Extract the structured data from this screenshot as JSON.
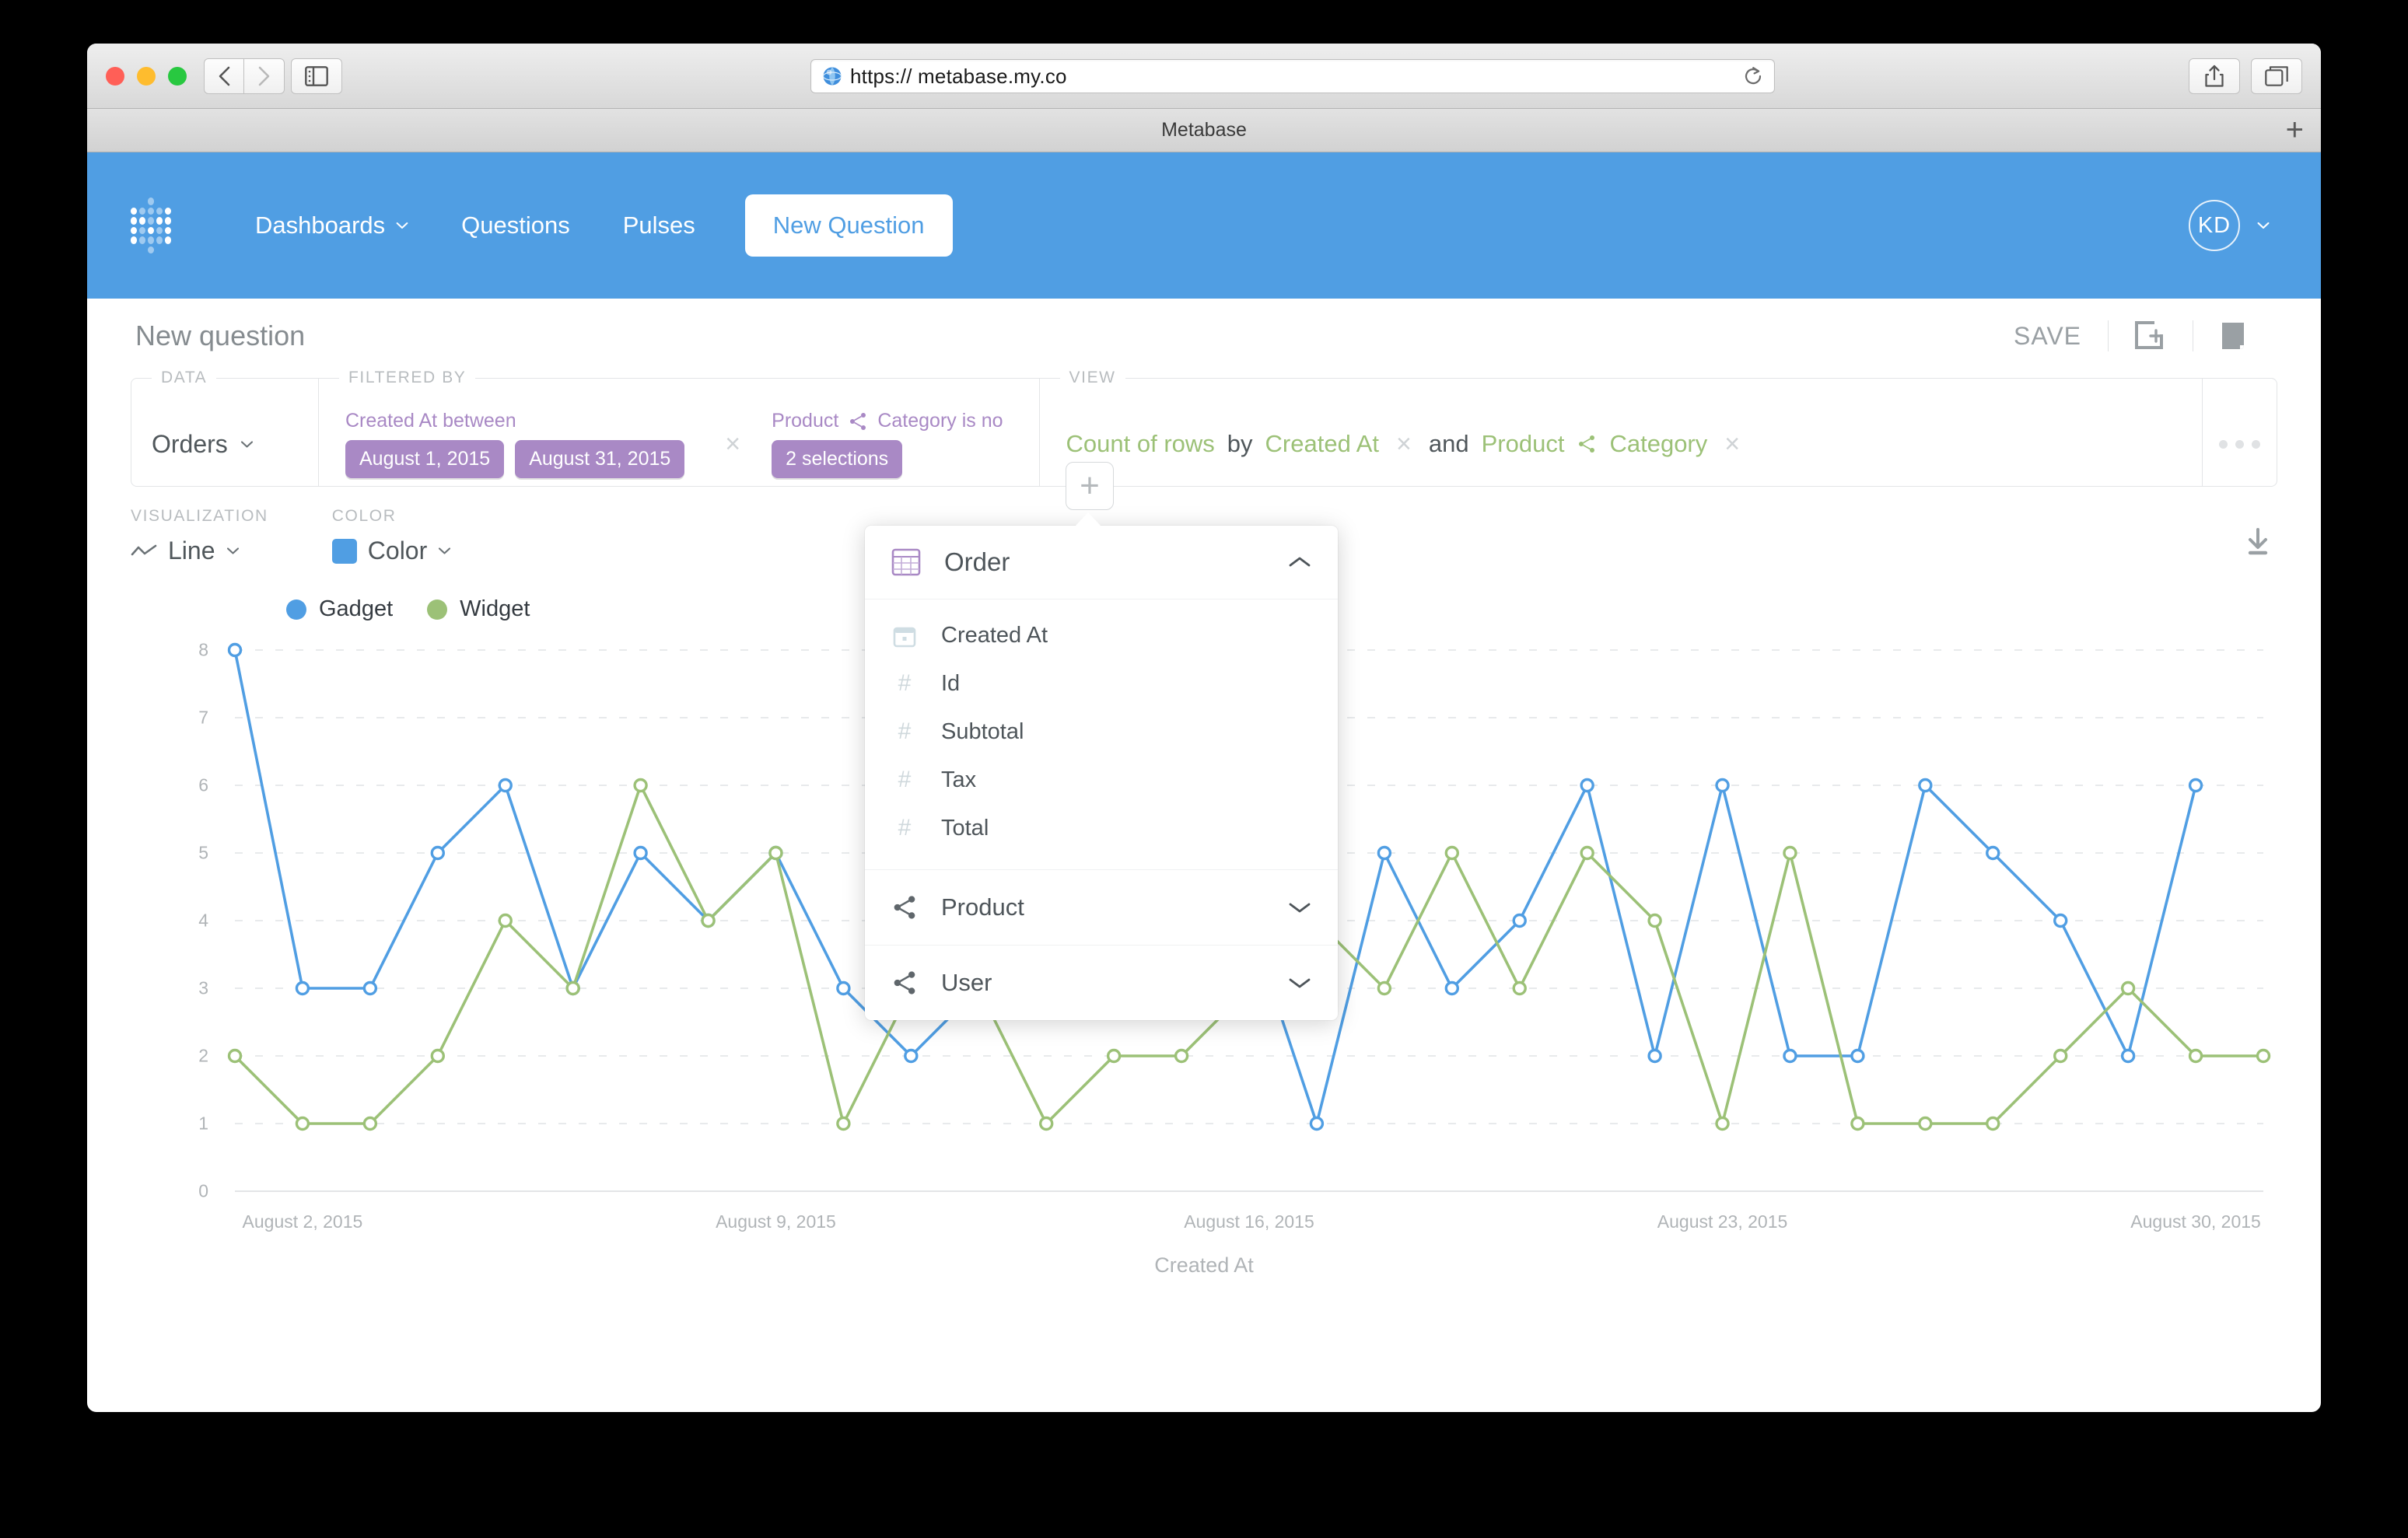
{
  "browser": {
    "url": "https:// metabase.my.co",
    "tab_title": "Metabase",
    "new_tab_label": "+",
    "back_icon": "chevron-left-icon",
    "forward_icon": "chevron-right-icon",
    "sidebar_icon": "sidebar-icon",
    "reload_icon": "reload-icon",
    "share_icon": "share-icon",
    "tabs_icon": "tabs-icon"
  },
  "nav": {
    "brand": "metabase-logo",
    "items": [
      {
        "label": "Dashboards",
        "has_caret": true
      },
      {
        "label": "Questions",
        "has_caret": false
      },
      {
        "label": "Pulses",
        "has_caret": false
      }
    ],
    "new_question": "New Question",
    "avatar_initials": "KD",
    "accent": "#509ee3"
  },
  "header": {
    "title": "New question",
    "save_label": "SAVE",
    "add_to_dashboard_icon": "add-to-dashboard-icon",
    "history_icon": "history-icon"
  },
  "query": {
    "data_label": "DATA",
    "data_value": "Orders",
    "filtered_label": "FILTERED BY",
    "filters": [
      {
        "title": "Created At between",
        "pills": [
          "August 1, 2015",
          "August 31, 2015"
        ],
        "remove": "×"
      },
      {
        "title_left": "Product",
        "title_right": "Category is no",
        "pills": [
          "2 selections"
        ],
        "join_icon": "join-icon"
      }
    ],
    "add_filter_label": "+",
    "view_label": "VIEW",
    "view": {
      "metric": "Count of rows",
      "by": "by",
      "dim1": "Created At",
      "remove1": "×",
      "and": "and",
      "dim2_table": "Product",
      "dim2_field": "Category",
      "remove2": "×",
      "join_icon": "join-icon"
    },
    "more_label": "…",
    "filter_color": "#a989c5",
    "view_color": "#9cc177"
  },
  "viz": {
    "visualization_label": "VISUALIZATION",
    "visualization_value": "Line",
    "color_label": "COLOR",
    "color_value": "Color",
    "color_swatch": "#509ee3",
    "download_icon": "download-icon"
  },
  "popover": {
    "section_title": "Order",
    "section_icon": "table-icon",
    "collapse_icon": "chevron-up-icon",
    "fields": [
      {
        "label": "Created At",
        "icon": "calendar-icon"
      },
      {
        "label": "Id",
        "icon": "number-icon"
      },
      {
        "label": "Subtotal",
        "icon": "number-icon"
      },
      {
        "label": "Tax",
        "icon": "number-icon"
      },
      {
        "label": "Total",
        "icon": "number-icon"
      }
    ],
    "sections": [
      {
        "label": "Product",
        "icon": "join-icon",
        "expand_icon": "chevron-down-icon"
      },
      {
        "label": "User",
        "icon": "join-icon",
        "expand_icon": "chevron-down-icon"
      }
    ]
  },
  "chart_data": {
    "type": "line",
    "title": "",
    "xlabel": "Created At",
    "ylabel": "",
    "ylim": [
      0,
      8
    ],
    "yticks": [
      0,
      1,
      2,
      3,
      4,
      5,
      6,
      7,
      8
    ],
    "grid": true,
    "legend_position": "top-left",
    "x": [
      "August 1, 2015",
      "August 2, 2015",
      "August 3, 2015",
      "August 4, 2015",
      "August 5, 2015",
      "August 6, 2015",
      "August 7, 2015",
      "August 8, 2015",
      "August 9, 2015",
      "August 10, 2015",
      "August 11, 2015",
      "August 12, 2015",
      "August 13, 2015",
      "August 14, 2015",
      "August 15, 2015",
      "August 16, 2015",
      "August 17, 2015",
      "August 18, 2015",
      "August 19, 2015",
      "August 20, 2015",
      "August 21, 2015",
      "August 22, 2015",
      "August 23, 2015",
      "August 24, 2015",
      "August 25, 2015",
      "August 26, 2015",
      "August 27, 2015",
      "August 28, 2015",
      "August 29, 2015",
      "August 30, 2015",
      "August 31, 2015"
    ],
    "xticklabels": [
      "August 2, 2015",
      "August 9, 2015",
      "August 16, 2015",
      "August 23, 2015",
      "August 30, 2015"
    ],
    "xtick_indices": [
      1,
      8,
      15,
      22,
      29
    ],
    "series": [
      {
        "name": "Gadget",
        "color": "#509ee3",
        "values": [
          8,
          3,
          3,
          5,
          6,
          3,
          5,
          4,
          5,
          3,
          2,
          3,
          6,
          3,
          7,
          4,
          1,
          5,
          3,
          4,
          6,
          2,
          6,
          2,
          2,
          6,
          5,
          4,
          2,
          6,
          null
        ]
      },
      {
        "name": "Widget",
        "color": "#9cc177",
        "values": [
          2,
          1,
          1,
          2,
          4,
          3,
          6,
          4,
          5,
          1,
          3,
          3,
          1,
          2,
          2,
          3,
          4,
          3,
          5,
          3,
          5,
          4,
          1,
          5,
          1,
          1,
          1,
          2,
          3,
          2,
          2
        ]
      }
    ]
  }
}
